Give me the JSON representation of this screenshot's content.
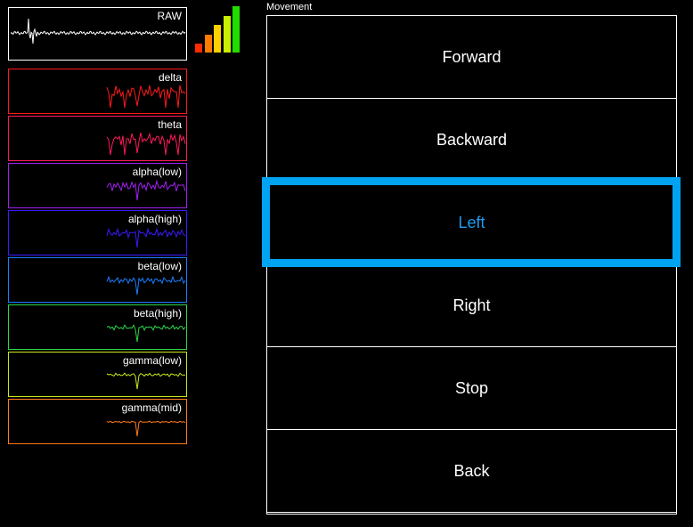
{
  "raw": {
    "label": "RAW"
  },
  "signals": [
    {
      "label": "delta",
      "color": "#ff1a1a"
    },
    {
      "label": "theta",
      "color": "#ff1a5a"
    },
    {
      "label": "alpha(low)",
      "color": "#a020f0"
    },
    {
      "label": "alpha(high)",
      "color": "#3a1aff"
    },
    {
      "label": "beta(low)",
      "color": "#1a7fff"
    },
    {
      "label": "beta(high)",
      "color": "#2ad84a"
    },
    {
      "label": "gamma(low)",
      "color": "#c8e81a"
    },
    {
      "label": "gamma(mid)",
      "color": "#ff7a1a"
    }
  ],
  "signal_quality": {
    "level": 5,
    "max": 5,
    "colors": [
      "#ff2a00",
      "#ff7a00",
      "#ffd000",
      "#c8f000",
      "#22dd00"
    ]
  },
  "movement": {
    "title": "Movement",
    "buttons": [
      "Forward",
      "Backward",
      "Left",
      "Right",
      "Stop",
      "Back"
    ],
    "selected": "Left",
    "selected_color": "#00a3f2"
  }
}
